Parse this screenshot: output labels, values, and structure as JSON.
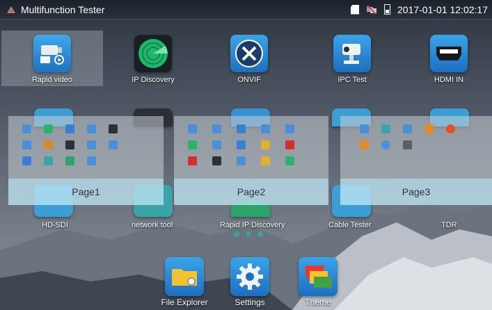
{
  "statusbar": {
    "title": "Multifunction Tester",
    "datetime": "2017-01-01 12:02:17"
  },
  "apps": {
    "rapid_video": "Rapid video",
    "ip_discovery": "IP Discovery",
    "onvif": "ONVIF",
    "ipc_test": "IPC Test",
    "hdmi_in": "HDMI IN",
    "hd_sdi": "HD-SDI",
    "network_tool": "network tool",
    "rapid_ip_discovery": "Rapid IP Discovery",
    "cable_tester": "Cable Tester",
    "tdr": "TDR"
  },
  "pages": {
    "page1": "Page1",
    "page2": "Page2",
    "page3": "Page3"
  },
  "dock": {
    "file_explorer": "File Explorer",
    "settings": "Settings",
    "theme": "Theme"
  }
}
